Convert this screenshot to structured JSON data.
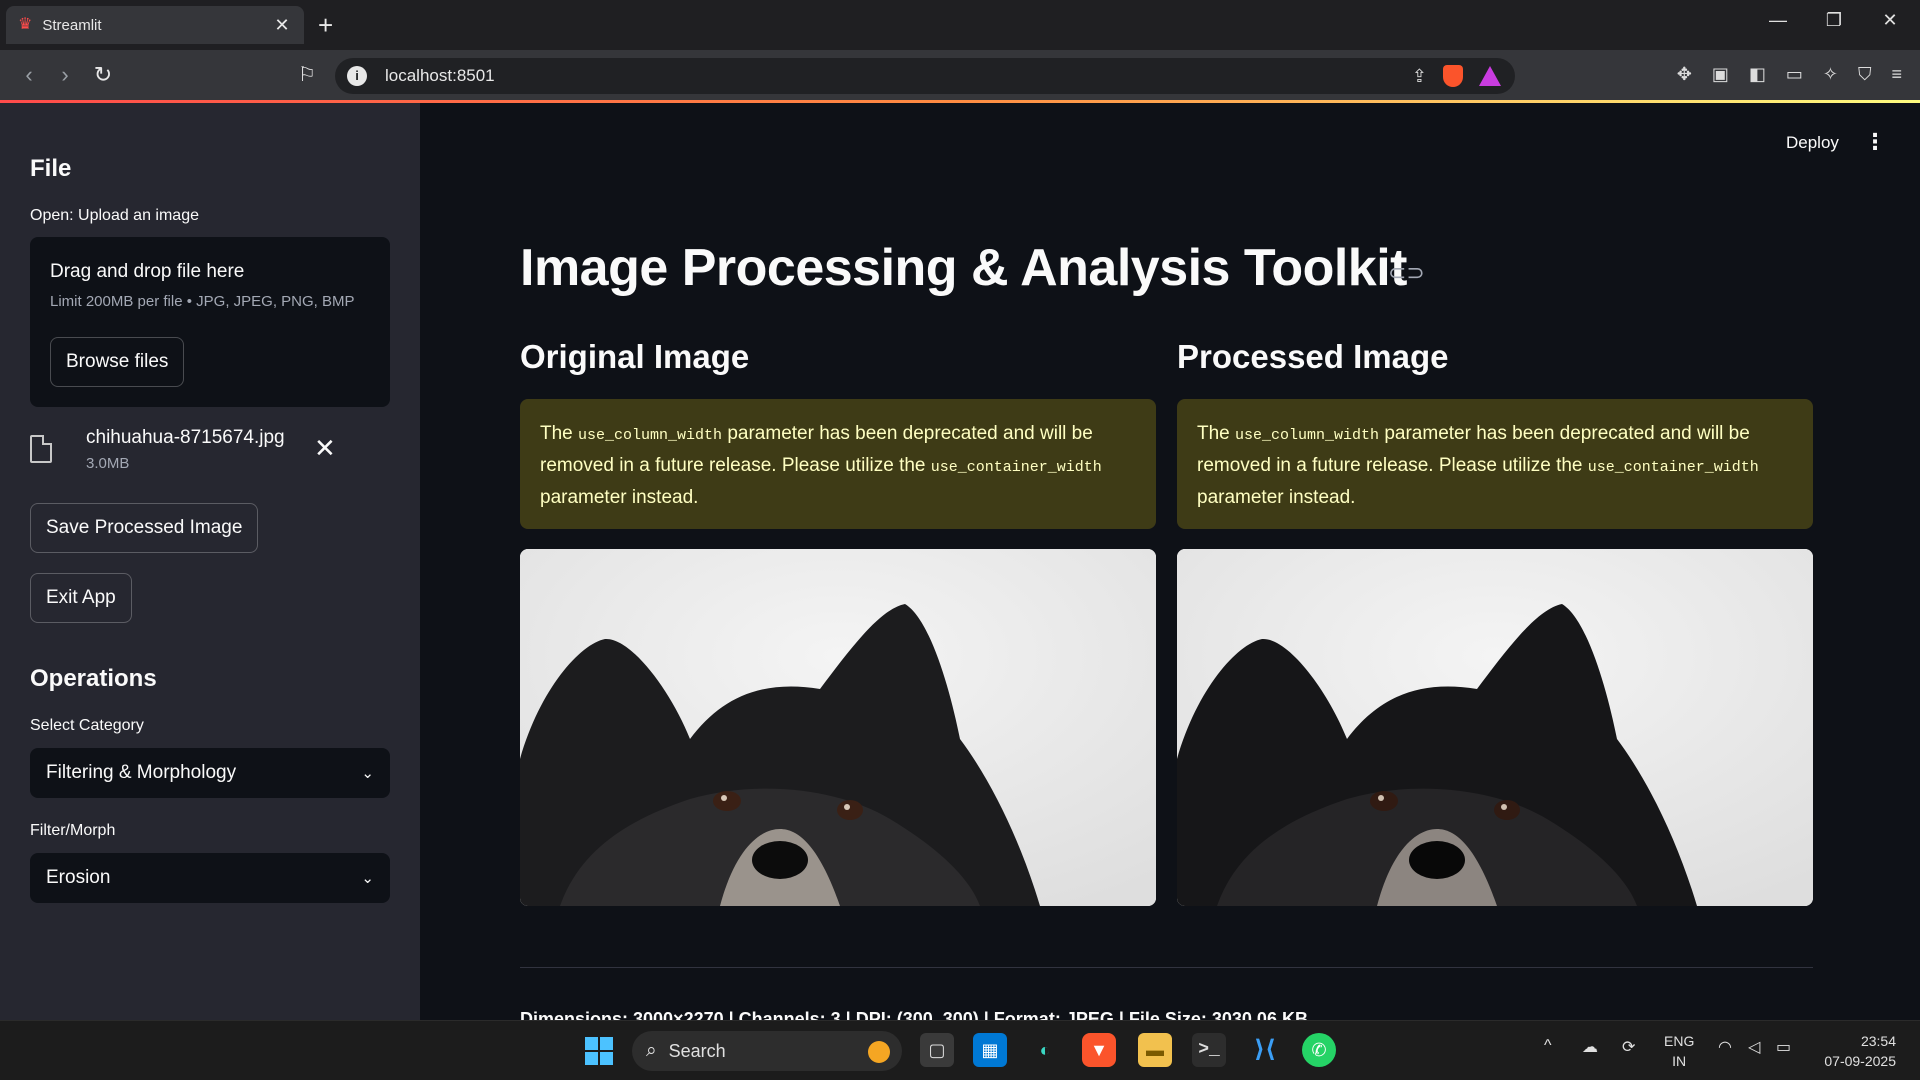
{
  "browser": {
    "tab_title": "Streamlit",
    "new_tab": "+",
    "tab_close": "✕",
    "url": "localhost:8501"
  },
  "sidebar": {
    "file_header": "File",
    "uploader_label": "Open: Upload an image",
    "dropzone_title": "Drag and drop file here",
    "dropzone_limit": "Limit 200MB per file • JPG, JPEG, PNG, BMP",
    "browse_label": "Browse files",
    "file_name": "chihuahua-8715674.jpg",
    "file_size": "3.0MB",
    "save_label": "Save Processed Image",
    "exit_label": "Exit App",
    "operations_header": "Operations",
    "category_label": "Select Category",
    "category_value": "Filtering & Morphology",
    "filter_label": "Filter/Morph",
    "filter_value": "Erosion"
  },
  "main": {
    "deploy_label": "Deploy",
    "title": "Image Processing & Analysis Toolkit",
    "original_header": "Original Image",
    "processed_header": "Processed Image",
    "warning": {
      "prefix": "The ",
      "param_old": "use_column_width",
      "middle": " parameter has been deprecated and will be removed in a future release. Please utilize the ",
      "param_new": "use_container_width",
      "suffix": " parameter instead."
    },
    "meta_line": "Dimensions: 3000×2270 | Channels: 3 | DPI: (300, 300) | Format: JPEG | File Size: 3030.06 KB"
  },
  "taskbar": {
    "search_label": "Search",
    "lang_top": "ENG",
    "lang_bottom": "IN",
    "time": "23:54",
    "date": "07-09-2025"
  },
  "colors": {
    "sidebar_bg": "#262730",
    "main_bg": "#0e1117",
    "warning_bg": "#3e3b16",
    "warning_text": "#ffffc2",
    "accent": "#ff4b4b"
  },
  "icons": [
    "streamlit-icon",
    "back-icon",
    "forward-icon",
    "reload-icon",
    "bookmark-icon",
    "info-icon",
    "share-icon",
    "brave-shield-icon",
    "brave-rewards-icon",
    "extensions-icon",
    "sidebar-icon",
    "wallet-icon",
    "leo-icon",
    "vpn-icon",
    "menu-icon",
    "file-icon",
    "close-icon",
    "chevron-down-icon",
    "link-icon",
    "kebab-icon",
    "windows-start-icon",
    "search-icon"
  ]
}
